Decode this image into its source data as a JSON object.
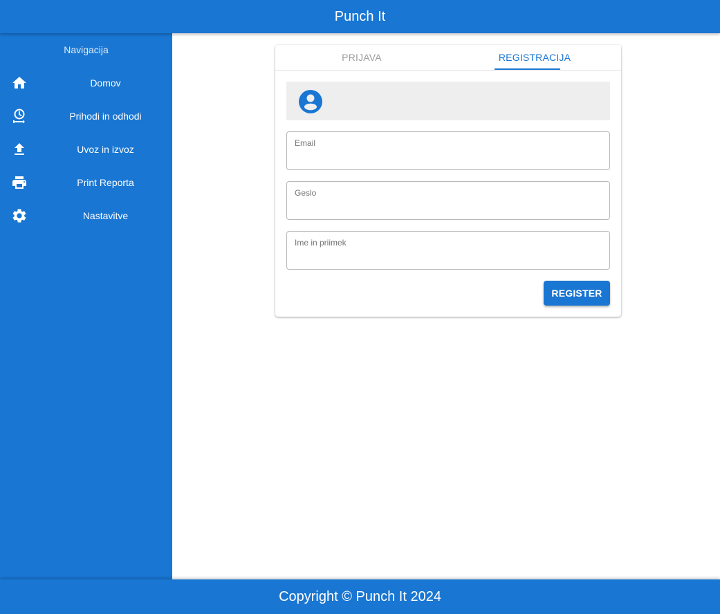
{
  "app": {
    "title": "Punch It"
  },
  "sidebar": {
    "title": "Navigacija",
    "items": [
      {
        "label": "Domov",
        "icon": "home-icon"
      },
      {
        "label": "Prihodi in odhodi",
        "icon": "clock-arrow-icon"
      },
      {
        "label": "Uvoz in izvoz",
        "icon": "upload-icon"
      },
      {
        "label": "Print Reporta",
        "icon": "printer-icon"
      },
      {
        "label": "Nastavitve",
        "icon": "gear-icon"
      }
    ]
  },
  "auth": {
    "tabs": [
      {
        "label": "PRIJAVA",
        "active": false
      },
      {
        "label": "REGISTRACIJA",
        "active": true
      }
    ],
    "avatar_icon": "account-circle-icon",
    "fields": {
      "email": {
        "label": "Email",
        "value": ""
      },
      "password": {
        "label": "Geslo",
        "value": ""
      },
      "full_name": {
        "label": "Ime in priimek",
        "value": ""
      }
    },
    "submit_label": "REGISTER"
  },
  "footer": {
    "text": "Copyright © Punch It 2024"
  },
  "colors": {
    "primary": "#1976d2",
    "inactive_tab": "#9e9e9e",
    "avatar_bg": "#eeeeee"
  }
}
